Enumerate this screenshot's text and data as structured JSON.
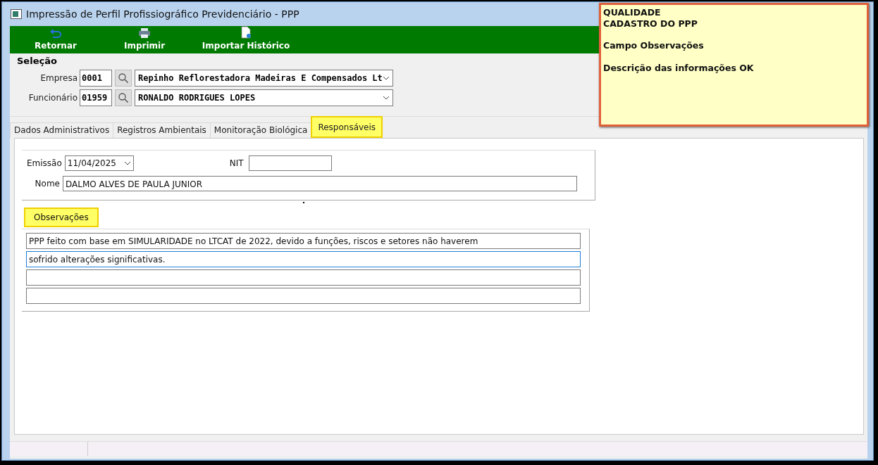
{
  "window": {
    "title": "Impressão de Perfil Profissiográfico Previdenciário - PPP"
  },
  "toolbar": [
    {
      "label": "Retornar",
      "kind": "return"
    },
    {
      "label": "Imprimir",
      "kind": "print"
    },
    {
      "label": "Importar Histórico",
      "kind": "import"
    }
  ],
  "selection": {
    "title": "Seleção",
    "fields": [
      {
        "label": "Empresa",
        "code": "0001",
        "value": "Repinho Reflorestadora Madeiras E Compensados Lt"
      },
      {
        "label": "Funcionário",
        "code": "01959",
        "value": "RONALDO RODRIGUES LOPES"
      }
    ]
  },
  "tabs": [
    {
      "label": "Dados Administrativos",
      "selected": false,
      "highlighted": false
    },
    {
      "label": "Registros Ambientais",
      "selected": false,
      "highlighted": false
    },
    {
      "label": "Monitoração Biológica",
      "selected": false,
      "highlighted": false
    },
    {
      "label": "Responsáveis",
      "selected": true,
      "highlighted": true
    }
  ],
  "responsaveis": {
    "emissao": {
      "label": "Emissão",
      "value": "11/04/2025"
    },
    "nit": {
      "label": "NIT"
    },
    "nome": {
      "label": "Nome",
      "value": "DALMO ALVES DE PAULA JUNIOR"
    }
  },
  "observacoes": {
    "label": "Observações",
    "highlighted": true,
    "lines": [
      {
        "value": "PPP feito com base em SIMULARIDADE no LTCAT de 2022, devido a funções, riscos e setores não haverem",
        "focused": false
      },
      {
        "value": "sofrido alterações significativas.",
        "focused": true
      },
      {
        "focused": false
      },
      {
        "focused": false
      }
    ]
  },
  "note": {
    "paragraphs": [
      [
        "QUALIDADE",
        "CADASTRO DO PPP"
      ],
      [
        "Campo Observações"
      ],
      [
        "Descrição das informações OK"
      ]
    ]
  }
}
